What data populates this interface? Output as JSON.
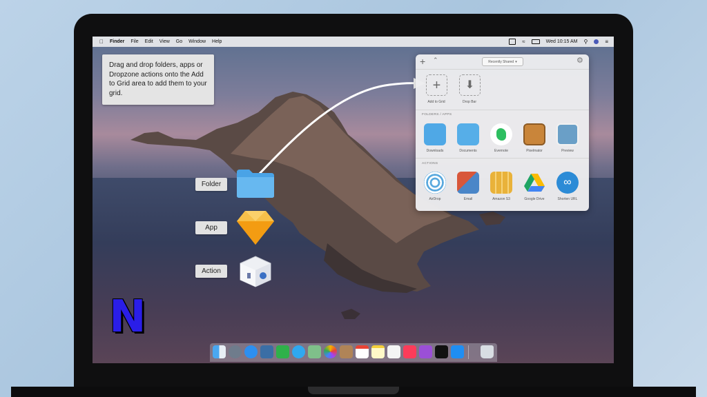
{
  "menubar": {
    "app_name": "Finder",
    "items": [
      "File",
      "Edit",
      "View",
      "Go",
      "Window",
      "Help"
    ],
    "clock": "Wed 10:15 AM"
  },
  "tooltip": {
    "text": "Drag and drop folders, apps or Dropzone actions onto the Add to Grid area to add them to your grid."
  },
  "drag_labels": {
    "folder": "Folder",
    "app": "App",
    "action": "Action"
  },
  "panel": {
    "dropdown": "Recently Shared",
    "top_slots": [
      {
        "label": "Add to Grid",
        "icon": "plus-icon"
      },
      {
        "label": "Drop Bar",
        "icon": "download-arrow-icon"
      }
    ],
    "folders_section": "FOLDERS / APPS",
    "folders": [
      {
        "label": "Downloads",
        "icon": "downloads-folder-icon",
        "color": "#4fa8e6"
      },
      {
        "label": "Documents",
        "icon": "documents-folder-icon",
        "color": "#56aee8"
      },
      {
        "label": "Evernote",
        "icon": "evernote-icon",
        "color": "#2dbe60"
      },
      {
        "label": "Pixelmator",
        "icon": "pixelmator-icon",
        "color": "#c9853a"
      },
      {
        "label": "Preview",
        "icon": "preview-icon",
        "color": "#6a9fc7"
      }
    ],
    "actions_section": "ACTIONS",
    "actions": [
      {
        "label": "AirDrop",
        "icon": "airdrop-icon",
        "color": "#5aa9de"
      },
      {
        "label": "Email",
        "icon": "email-icon",
        "color": "#d8573a"
      },
      {
        "label": "Amazon S3",
        "icon": "amazon-s3-icon",
        "color": "#e9b23a"
      },
      {
        "label": "Google Drive",
        "icon": "google-drive-icon",
        "color": "#1fa463"
      },
      {
        "label": "Shorten URL",
        "icon": "shorten-url-icon",
        "color": "#2c8bd6"
      }
    ]
  },
  "logo_letter": "N",
  "dock_icons": [
    "finder-icon",
    "launchpad-icon",
    "safari-icon",
    "photo-browser-icon",
    "facetime-icon",
    "messages-icon",
    "maps-icon",
    "photos-icon",
    "contacts-icon",
    "calendar-icon",
    "notes-icon",
    "reminders-icon",
    "music-icon",
    "podcasts-icon",
    "tv-icon",
    "app-store-icon",
    "trash-icon"
  ]
}
